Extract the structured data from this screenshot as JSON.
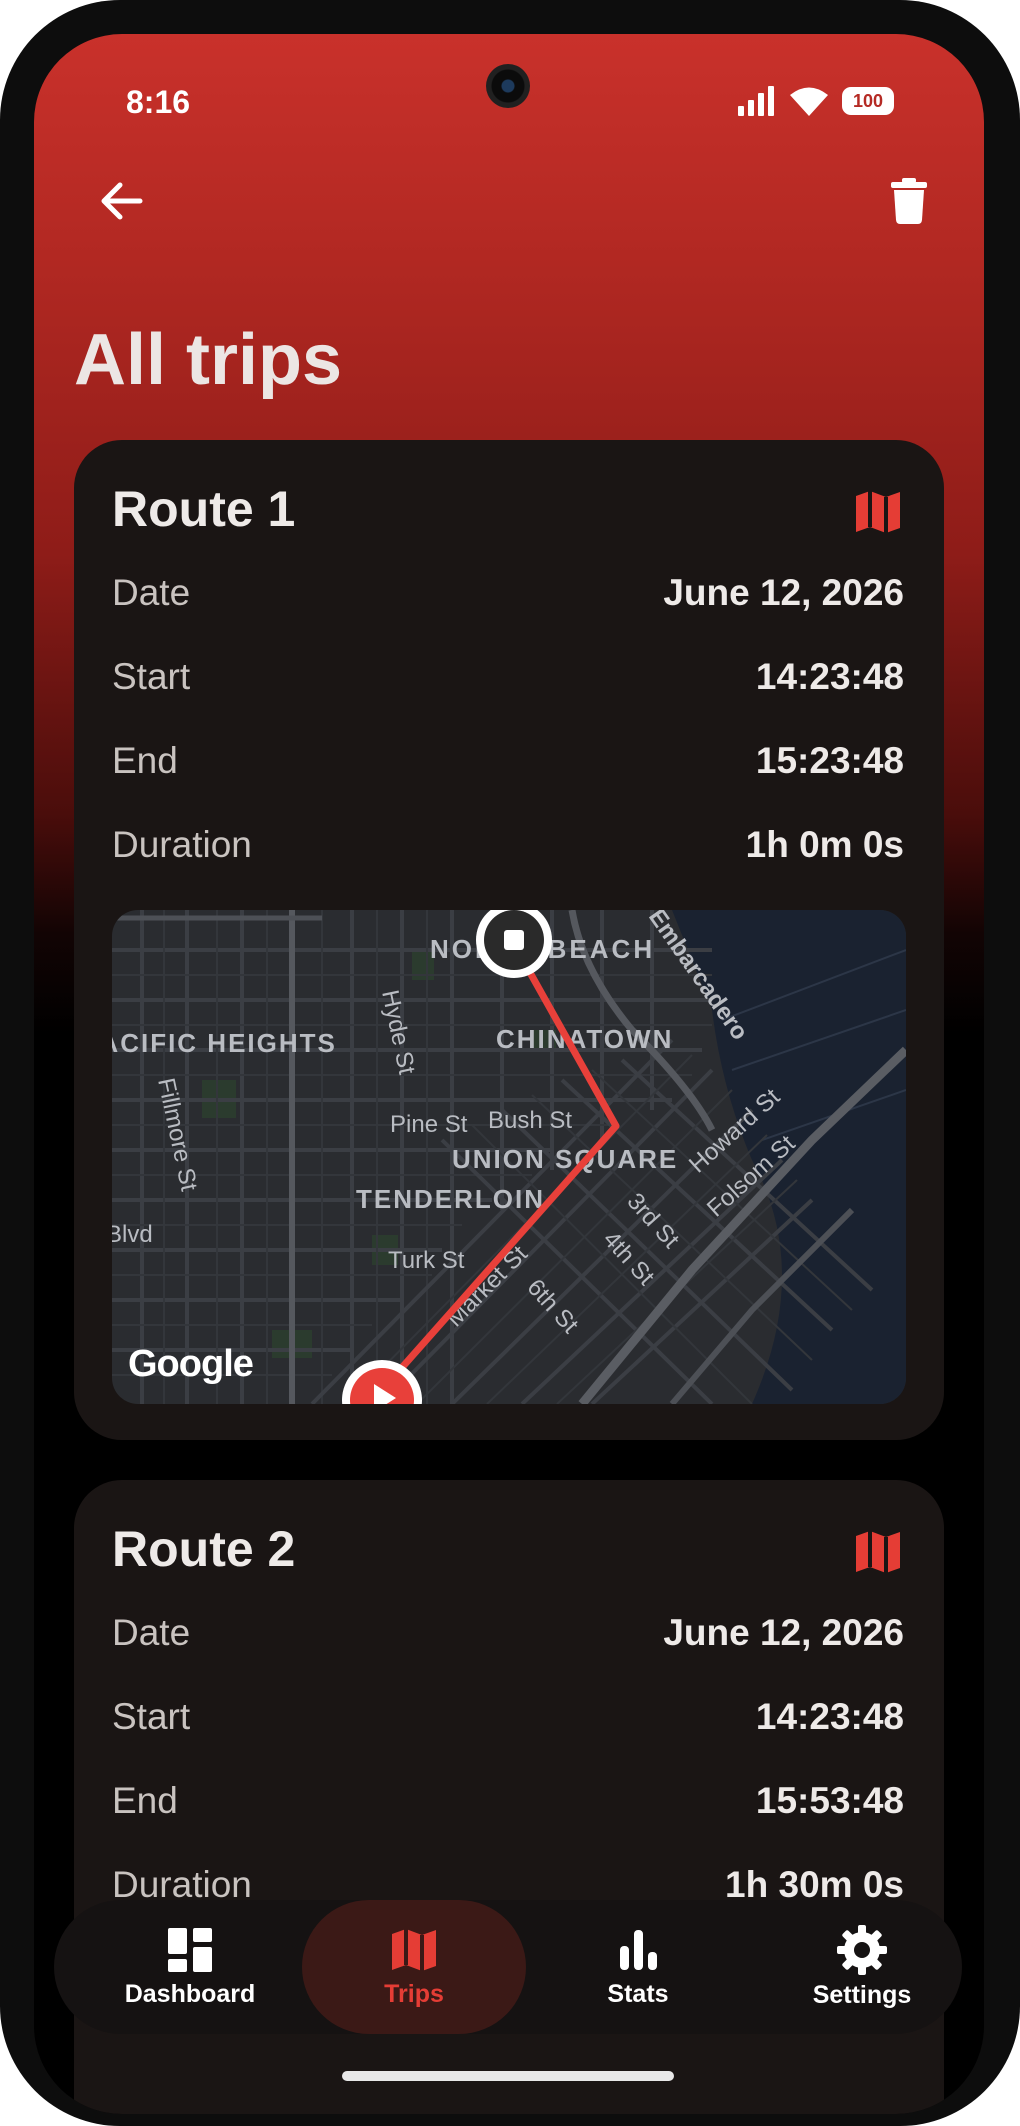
{
  "status_bar": {
    "time": "8:16",
    "battery": "100",
    "signal_icon": "cell-signal-icon",
    "wifi_icon": "wifi-icon"
  },
  "header": {
    "title": "All trips",
    "back_icon": "arrow-left-icon",
    "delete_icon": "trash-icon"
  },
  "routes": [
    {
      "title": "Route 1",
      "rows": [
        {
          "label": "Date",
          "value": "June 12, 2026"
        },
        {
          "label": "Start",
          "value": "14:23:48"
        },
        {
          "label": "End",
          "value": "15:23:48"
        },
        {
          "label": "Duration",
          "value": "1h 0m 0s"
        }
      ],
      "map": {
        "labels": {
          "north_beach": "NORTH BEACH",
          "embarcadero": "Embarcadero",
          "pacific_heights": "PACIFIC HEIGHTS",
          "chinatown": "CHINATOWN",
          "hyde": "Hyde St",
          "fillmore": "Fillmore St",
          "pine": "Pine St",
          "bush": "Bush St",
          "union_square": "UNION SQUARE",
          "howard": "Howard St",
          "folsom": "Folsom St",
          "tenderloin": "TENDERLOIN",
          "blvd": "Blvd",
          "third": "3rd St",
          "fourth": "4th St",
          "turk": "Turk St",
          "market": "Market St",
          "sixth": "6th St"
        },
        "attribution": "Google"
      }
    },
    {
      "title": "Route 2",
      "rows": [
        {
          "label": "Date",
          "value": "June 12, 2026"
        },
        {
          "label": "Start",
          "value": "14:23:48"
        },
        {
          "label": "End",
          "value": "15:53:48"
        },
        {
          "label": "Duration",
          "value": "1h 30m 0s"
        }
      ]
    }
  ],
  "bottom_nav": {
    "items": [
      {
        "label": "Dashboard",
        "icon": "dashboard-icon"
      },
      {
        "label": "Trips",
        "icon": "map-icon",
        "active": true
      },
      {
        "label": "Stats",
        "icon": "bar-chart-icon"
      },
      {
        "label": "Settings",
        "icon": "gear-icon"
      }
    ]
  },
  "colors": {
    "accent": "#e53d35",
    "header_red": "#c9312b",
    "card_bg": "#1a1514",
    "route_line": "#e8403a"
  }
}
